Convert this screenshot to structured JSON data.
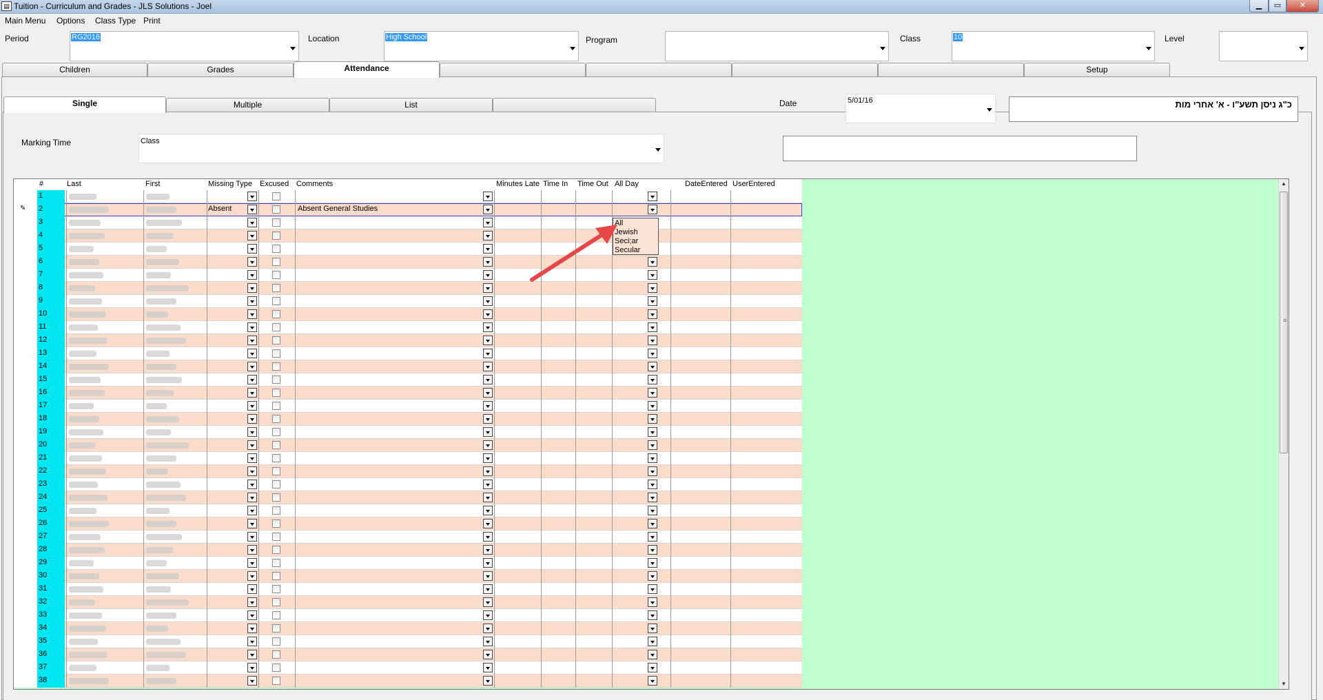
{
  "window": {
    "title": "Tuition - Curriculum and Grades - JLS Solutions - Joel"
  },
  "menu": [
    "Main Menu",
    "Options",
    "Class Type",
    "Print"
  ],
  "filters": {
    "period": {
      "label": "Period",
      "value": "RG2016"
    },
    "location": {
      "label": "Location",
      "value": "High School"
    },
    "program": {
      "label": "Program",
      "value": ""
    },
    "class": {
      "label": "Class",
      "value": "10"
    },
    "level": {
      "label": "Level",
      "value": ""
    }
  },
  "main_tabs": [
    "Children",
    "Grades",
    "Attendance",
    "",
    "",
    "",
    "",
    "Setup"
  ],
  "active_main_tab": "Attendance",
  "sub_tabs": [
    "Single",
    "Multiple",
    "List",
    ""
  ],
  "active_sub_tab": "Single",
  "date": {
    "label": "Date",
    "value": "5/01/16"
  },
  "hebrew_date": "כ\"ג ניסן תשע\"ו - א' אחרי מות",
  "marking_time": {
    "label": "Marking Time",
    "value": "Class"
  },
  "grid": {
    "columns": [
      "#",
      "Last",
      "First",
      "Missing Type",
      "Excused",
      "Comments",
      "Minutes Late",
      "Time In",
      "Time Out",
      "All Day",
      "DateEntered",
      "UserEntered"
    ],
    "current_row": 2,
    "current_row_missing_type": "Absent",
    "current_row_comment": "Absent General Studies",
    "row_numbers": [
      "1",
      "2",
      "3",
      "4",
      "5",
      "6",
      "7",
      "8",
      "9",
      "10",
      "11",
      "12",
      "13",
      "14",
      "15",
      "16",
      "17",
      "18",
      "19",
      "20",
      "21",
      "22",
      "23",
      "24",
      "25",
      "26",
      "27",
      "28",
      "29",
      "30",
      "31",
      "32",
      "33",
      "34",
      "35",
      "36",
      "37",
      "38"
    ]
  },
  "all_day_dropdown": [
    "All",
    "Jewish",
    "Seci;ar",
    "Secular"
  ],
  "colors": {
    "row_alt": "#fbdccb",
    "number_col": "#00e6f0",
    "grid_bg": "#bfffcf",
    "selection": "#3399ff",
    "annotation_arrow": "#e8474a"
  }
}
